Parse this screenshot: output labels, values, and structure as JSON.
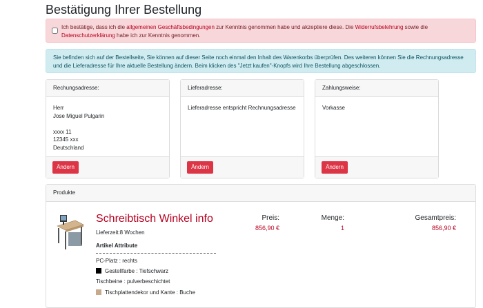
{
  "title": "Bestätigung Ihrer Bestellung",
  "terms": {
    "part1": "Ich bestätige, dass ich die ",
    "link_agb": "allgemeinen Geschäftsbedingungen",
    "part2": " zur Kenntnis genommen habe und akzeptiere diese. Die ",
    "link_widerruf": "Widerrufsbelehrung",
    "part3": " sowie die ",
    "link_datenschutz": "Datenschutzerklärung",
    "part4": " habe ich zur Kenntnis genommen.",
    "checked": false
  },
  "info": "Sie befinden sich auf der Bestellseite, Sie können auf dieser Seite noch einmal den Inhalt des Warenkorbs überprüfen. Des weiteren können Sie die Rechnungsadresse und die Lieferadresse für Ihre aktuelle Bestellung ändern. Beim klicken des \"Jetzt kaufen\"-Knopfs wird Ihre Bestellung abgeschlossen.",
  "billing": {
    "header": "Rechungsadresse:",
    "salutation": "Herr",
    "name": "Jose Miguel Pulgarin",
    "street": "xxxx 11",
    "city": "12345 xxx",
    "country": "Deutschland",
    "button": "Ändern"
  },
  "shipping": {
    "header": "Lieferadresse:",
    "text": "Lieferadresse entspricht Rechnungsadresse",
    "button": "Ändern"
  },
  "payment": {
    "header": "Zahlungsweise:",
    "text": "Vorkasse",
    "button": "Ändern"
  },
  "products": {
    "header": "Produkte",
    "item": {
      "name": "Schreibtisch Winkel info",
      "delivery": "Lieferzeit:8 Wochen",
      "attributes_title": "Artikel Attribute",
      "attr1": "PC-Platz : rechts",
      "attr2": "Gestellfarbe : Tiefschwarz",
      "attr2_color": "#000000",
      "attr3": "Tischbeine : pulverbeschichtet",
      "attr4": "Tischplattendekor und Kante : Buche",
      "attr4_color": "#c9a98c",
      "price_label": "Preis:",
      "price": "856,90 €",
      "qty_label": "Menge:",
      "qty": "1",
      "total_label": "Gesamtpreis:",
      "total": "856,90 €"
    }
  }
}
